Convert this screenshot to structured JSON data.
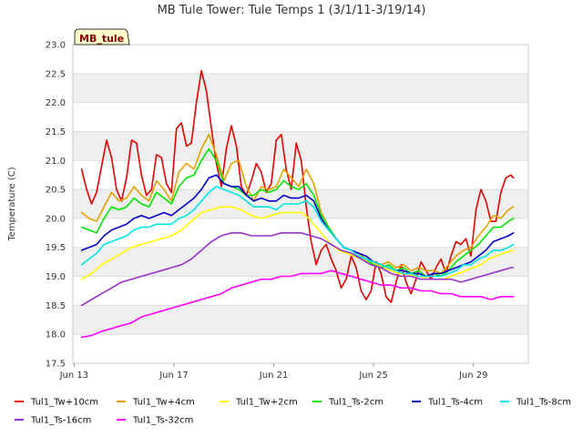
{
  "chart_data": {
    "type": "line",
    "title": "MB Tule Tower: Tule Temps 1 (3/1/11-3/19/14)",
    "xlabel": "",
    "ylabel": "Temperature (C)",
    "ylim": [
      17.5,
      23.0
    ],
    "yticks": [
      "17.5",
      "18.0",
      "18.5",
      "19.0",
      "19.5",
      "20.0",
      "20.5",
      "21.0",
      "21.5",
      "22.0",
      "22.5",
      "23.0"
    ],
    "xlim": [
      12.95,
      31.2
    ],
    "xticks": [
      {
        "value": 13,
        "label": "Jun 13"
      },
      {
        "value": 17,
        "label": "Jun 17"
      },
      {
        "value": 21,
        "label": "Jun 21"
      },
      {
        "value": 25,
        "label": "Jun 25"
      },
      {
        "value": 29,
        "label": "Jun 29"
      }
    ],
    "badge": "MB_tule",
    "band_color": "#efefef",
    "legend_position": "bottom",
    "series": [
      {
        "name": "Tul1_Tw+10cm",
        "color": "#e60000",
        "x": [
          13.3,
          13.5,
          13.7,
          13.9,
          14.1,
          14.3,
          14.5,
          14.7,
          14.9,
          15.1,
          15.3,
          15.5,
          15.7,
          15.9,
          16.1,
          16.3,
          16.5,
          16.7,
          16.9,
          17.1,
          17.3,
          17.5,
          17.7,
          17.9,
          18.1,
          18.3,
          18.5,
          18.7,
          18.9,
          19.1,
          19.3,
          19.5,
          19.7,
          19.9,
          20.1,
          20.3,
          20.5,
          20.7,
          20.9,
          21.1,
          21.3,
          21.5,
          21.7,
          21.9,
          22.1,
          22.3,
          22.5,
          22.7,
          22.9,
          23.1,
          23.3,
          23.5,
          23.7,
          23.9,
          24.1,
          24.3,
          24.5,
          24.7,
          24.9,
          25.1,
          25.3,
          25.5,
          25.7,
          25.9,
          26.1,
          26.3,
          26.5,
          26.7,
          26.9,
          27.1,
          27.3,
          27.5,
          27.7,
          27.9,
          28.1,
          28.3,
          28.5,
          28.7,
          28.9,
          29.1,
          29.3,
          29.5,
          29.7,
          29.9,
          30.1,
          30.3,
          30.5,
          30.6
        ],
        "y": [
          20.85,
          20.5,
          20.25,
          20.45,
          20.9,
          21.35,
          21.05,
          20.5,
          20.3,
          20.7,
          21.35,
          21.3,
          20.75,
          20.4,
          20.5,
          21.1,
          21.05,
          20.6,
          20.45,
          21.55,
          21.65,
          21.25,
          21.3,
          22.0,
          22.55,
          22.2,
          21.55,
          20.95,
          20.55,
          21.2,
          21.6,
          21.25,
          20.55,
          20.4,
          20.65,
          20.95,
          20.8,
          20.45,
          20.6,
          21.35,
          21.45,
          20.85,
          20.5,
          21.3,
          21.0,
          20.2,
          19.6,
          19.2,
          19.45,
          19.55,
          19.3,
          19.1,
          18.8,
          18.95,
          19.35,
          19.15,
          18.75,
          18.6,
          18.75,
          19.25,
          19.05,
          18.65,
          18.55,
          18.9,
          19.2,
          18.9,
          18.7,
          18.95,
          19.25,
          19.1,
          18.95,
          19.15,
          19.3,
          19.05,
          19.35,
          19.6,
          19.55,
          19.65,
          19.35,
          20.15,
          20.5,
          20.3,
          19.95,
          19.95,
          20.45,
          20.7,
          20.75,
          20.7
        ]
      },
      {
        "name": "Tul1_Tw+4cm",
        "color": "#e6a000",
        "x": [
          13.3,
          13.6,
          13.9,
          14.2,
          14.5,
          14.8,
          15.1,
          15.4,
          15.7,
          16.0,
          16.3,
          16.6,
          16.9,
          17.2,
          17.5,
          17.8,
          18.1,
          18.4,
          18.7,
          19.0,
          19.3,
          19.6,
          19.9,
          20.2,
          20.5,
          20.8,
          21.1,
          21.4,
          21.7,
          22.0,
          22.3,
          22.6,
          22.9,
          23.2,
          23.5,
          23.8,
          24.1,
          24.4,
          24.7,
          25.0,
          25.3,
          25.6,
          25.9,
          26.2,
          26.5,
          26.8,
          27.1,
          27.4,
          27.7,
          28.0,
          28.3,
          28.6,
          28.9,
          29.2,
          29.5,
          29.8,
          30.1,
          30.4,
          30.6
        ],
        "y": [
          20.1,
          20.0,
          19.95,
          20.2,
          20.45,
          20.3,
          20.35,
          20.55,
          20.4,
          20.3,
          20.65,
          20.5,
          20.3,
          20.8,
          20.95,
          20.85,
          21.2,
          21.45,
          21.1,
          20.65,
          20.95,
          21.0,
          20.55,
          20.3,
          20.55,
          20.5,
          20.55,
          20.85,
          20.7,
          20.55,
          20.85,
          20.6,
          20.1,
          19.85,
          19.65,
          19.5,
          19.45,
          19.4,
          19.3,
          19.25,
          19.2,
          19.25,
          19.15,
          19.2,
          19.1,
          19.15,
          19.1,
          19.1,
          19.05,
          19.2,
          19.35,
          19.45,
          19.5,
          19.7,
          19.85,
          20.05,
          20.0,
          20.15,
          20.2
        ]
      },
      {
        "name": "Tul1_Tw+2cm",
        "color": "#ffff00",
        "x": [
          13.3,
          13.7,
          14.1,
          14.5,
          14.9,
          15.3,
          15.7,
          16.1,
          16.5,
          16.9,
          17.3,
          17.7,
          18.1,
          18.5,
          18.9,
          19.3,
          19.7,
          20.1,
          20.5,
          20.9,
          21.3,
          21.7,
          22.1,
          22.4,
          22.7,
          23.0,
          23.3,
          23.6,
          23.9,
          24.2,
          24.5,
          24.8,
          25.1,
          25.4,
          25.7,
          26.0,
          26.3,
          26.6,
          26.9,
          27.2,
          27.5,
          27.8,
          28.1,
          28.4,
          28.7,
          29.0,
          29.3,
          29.6,
          29.9,
          30.2,
          30.6
        ],
        "y": [
          18.95,
          19.05,
          19.2,
          19.3,
          19.4,
          19.5,
          19.55,
          19.6,
          19.65,
          19.7,
          19.8,
          19.95,
          20.1,
          20.15,
          20.2,
          20.2,
          20.15,
          20.05,
          20.0,
          20.05,
          20.1,
          20.1,
          20.1,
          20.0,
          19.85,
          19.7,
          19.55,
          19.45,
          19.4,
          19.35,
          19.3,
          19.25,
          19.2,
          19.15,
          19.1,
          19.05,
          19.05,
          19.0,
          19.0,
          18.95,
          18.95,
          18.95,
          19.0,
          19.05,
          19.1,
          19.15,
          19.2,
          19.3,
          19.35,
          19.4,
          19.45
        ]
      },
      {
        "name": "Tul1_Ts-2cm",
        "color": "#00e600",
        "x": [
          13.3,
          13.6,
          13.9,
          14.2,
          14.5,
          14.8,
          15.1,
          15.4,
          15.7,
          16.0,
          16.3,
          16.6,
          16.9,
          17.2,
          17.5,
          17.8,
          18.1,
          18.4,
          18.7,
          19.0,
          19.3,
          19.6,
          19.9,
          20.2,
          20.5,
          20.8,
          21.1,
          21.4,
          21.7,
          22.0,
          22.3,
          22.6,
          22.9,
          23.2,
          23.5,
          23.8,
          24.1,
          24.4,
          24.7,
          25.0,
          25.3,
          25.6,
          25.9,
          26.2,
          26.5,
          26.8,
          27.1,
          27.4,
          27.7,
          28.0,
          28.3,
          28.6,
          28.9,
          29.2,
          29.5,
          29.8,
          30.1,
          30.4,
          30.6
        ],
        "y": [
          19.85,
          19.8,
          19.75,
          20.0,
          20.2,
          20.15,
          20.2,
          20.35,
          20.25,
          20.2,
          20.45,
          20.35,
          20.25,
          20.55,
          20.7,
          20.75,
          21.0,
          21.2,
          21.0,
          20.6,
          20.55,
          20.5,
          20.4,
          20.4,
          20.5,
          20.45,
          20.5,
          20.65,
          20.55,
          20.5,
          20.6,
          20.4,
          20.05,
          19.85,
          19.65,
          19.5,
          19.45,
          19.35,
          19.3,
          19.2,
          19.15,
          19.2,
          19.1,
          19.15,
          19.05,
          19.1,
          19.0,
          19.05,
          19.0,
          19.1,
          19.25,
          19.35,
          19.45,
          19.55,
          19.7,
          19.85,
          19.85,
          19.95,
          20.0
        ]
      },
      {
        "name": "Tul1_Ts-4cm",
        "color": "#0000cc",
        "x": [
          13.3,
          13.6,
          13.9,
          14.2,
          14.5,
          14.8,
          15.1,
          15.4,
          15.7,
          16.0,
          16.3,
          16.6,
          16.9,
          17.2,
          17.5,
          17.8,
          18.1,
          18.4,
          18.7,
          19.0,
          19.3,
          19.6,
          19.9,
          20.2,
          20.5,
          20.8,
          21.1,
          21.4,
          21.7,
          22.0,
          22.3,
          22.6,
          22.9,
          23.2,
          23.5,
          23.8,
          24.1,
          24.4,
          24.7,
          25.0,
          25.3,
          25.6,
          25.9,
          26.2,
          26.5,
          26.8,
          27.1,
          27.4,
          27.7,
          28.0,
          28.3,
          28.6,
          28.9,
          29.2,
          29.5,
          29.8,
          30.1,
          30.4,
          30.6
        ],
        "y": [
          19.45,
          19.5,
          19.55,
          19.7,
          19.8,
          19.85,
          19.9,
          20.0,
          20.05,
          20.0,
          20.05,
          20.1,
          20.05,
          20.15,
          20.25,
          20.35,
          20.5,
          20.7,
          20.75,
          20.6,
          20.55,
          20.55,
          20.4,
          20.3,
          20.35,
          20.3,
          20.3,
          20.4,
          20.35,
          20.35,
          20.4,
          20.3,
          20.0,
          19.8,
          19.65,
          19.5,
          19.45,
          19.4,
          19.35,
          19.25,
          19.2,
          19.15,
          19.1,
          19.1,
          19.05,
          19.05,
          19.0,
          19.05,
          19.05,
          19.1,
          19.15,
          19.2,
          19.25,
          19.35,
          19.45,
          19.6,
          19.65,
          19.7,
          19.75
        ]
      },
      {
        "name": "Tul1_Ts-8cm",
        "color": "#00e6e6",
        "x": [
          13.3,
          13.6,
          13.9,
          14.2,
          14.5,
          14.8,
          15.1,
          15.4,
          15.7,
          16.0,
          16.3,
          16.6,
          16.9,
          17.2,
          17.5,
          17.8,
          18.1,
          18.4,
          18.7,
          19.0,
          19.3,
          19.6,
          19.9,
          20.2,
          20.5,
          20.8,
          21.1,
          21.4,
          21.7,
          22.0,
          22.3,
          22.6,
          22.9,
          23.2,
          23.5,
          23.8,
          24.1,
          24.4,
          24.7,
          25.0,
          25.3,
          25.6,
          25.9,
          26.2,
          26.5,
          26.8,
          27.1,
          27.4,
          27.7,
          28.0,
          28.3,
          28.6,
          28.9,
          29.2,
          29.5,
          29.8,
          30.1,
          30.4,
          30.6
        ],
        "y": [
          19.2,
          19.3,
          19.4,
          19.55,
          19.6,
          19.65,
          19.7,
          19.8,
          19.85,
          19.85,
          19.9,
          19.9,
          19.9,
          20.0,
          20.05,
          20.15,
          20.3,
          20.45,
          20.55,
          20.5,
          20.45,
          20.4,
          20.3,
          20.2,
          20.2,
          20.2,
          20.15,
          20.25,
          20.25,
          20.25,
          20.3,
          20.2,
          19.95,
          19.8,
          19.65,
          19.5,
          19.45,
          19.35,
          19.3,
          19.25,
          19.2,
          19.15,
          19.1,
          19.05,
          19.05,
          19.0,
          19.0,
          19.0,
          19.0,
          19.05,
          19.1,
          19.2,
          19.2,
          19.3,
          19.35,
          19.45,
          19.45,
          19.5,
          19.55
        ]
      },
      {
        "name": "Tul1_Ts-16cm",
        "color": "#9933cc",
        "x": [
          13.3,
          13.7,
          14.1,
          14.5,
          14.9,
          15.3,
          15.7,
          16.1,
          16.5,
          16.9,
          17.3,
          17.7,
          18.1,
          18.5,
          18.9,
          19.3,
          19.7,
          20.1,
          20.5,
          20.9,
          21.3,
          21.7,
          22.1,
          22.5,
          22.9,
          23.3,
          23.7,
          24.1,
          24.5,
          24.9,
          25.3,
          25.7,
          26.1,
          26.5,
          26.9,
          27.3,
          27.7,
          28.1,
          28.5,
          28.9,
          29.3,
          29.7,
          30.1,
          30.5,
          30.6
        ],
        "y": [
          18.5,
          18.6,
          18.7,
          18.8,
          18.9,
          18.95,
          19.0,
          19.05,
          19.1,
          19.15,
          19.2,
          19.3,
          19.45,
          19.6,
          19.7,
          19.75,
          19.75,
          19.7,
          19.7,
          19.7,
          19.75,
          19.75,
          19.75,
          19.7,
          19.65,
          19.55,
          19.45,
          19.4,
          19.3,
          19.2,
          19.15,
          19.05,
          19.0,
          19.0,
          18.95,
          18.95,
          18.95,
          18.95,
          18.9,
          18.95,
          19.0,
          19.05,
          19.1,
          19.15,
          19.15
        ]
      },
      {
        "name": "Tul1_Ts-32cm",
        "color": "#ff00ff",
        "x": [
          13.3,
          13.7,
          14.1,
          14.5,
          14.9,
          15.3,
          15.7,
          16.1,
          16.5,
          16.9,
          17.3,
          17.7,
          18.1,
          18.5,
          18.9,
          19.3,
          19.7,
          20.1,
          20.5,
          20.9,
          21.3,
          21.7,
          22.1,
          22.5,
          22.9,
          23.3,
          23.7,
          24.1,
          24.5,
          24.9,
          25.3,
          25.7,
          26.1,
          26.5,
          26.9,
          27.3,
          27.7,
          28.1,
          28.5,
          28.9,
          29.3,
          29.7,
          30.1,
          30.5,
          30.6
        ],
        "y": [
          17.95,
          17.98,
          18.05,
          18.1,
          18.15,
          18.2,
          18.3,
          18.35,
          18.4,
          18.45,
          18.5,
          18.55,
          18.6,
          18.65,
          18.7,
          18.8,
          18.85,
          18.9,
          18.95,
          18.95,
          19.0,
          19.0,
          19.05,
          19.05,
          19.05,
          19.1,
          19.05,
          19.0,
          18.95,
          18.9,
          18.85,
          18.85,
          18.8,
          18.8,
          18.75,
          18.75,
          18.7,
          18.7,
          18.65,
          18.65,
          18.65,
          18.6,
          18.65,
          18.65,
          18.65
        ]
      }
    ]
  }
}
